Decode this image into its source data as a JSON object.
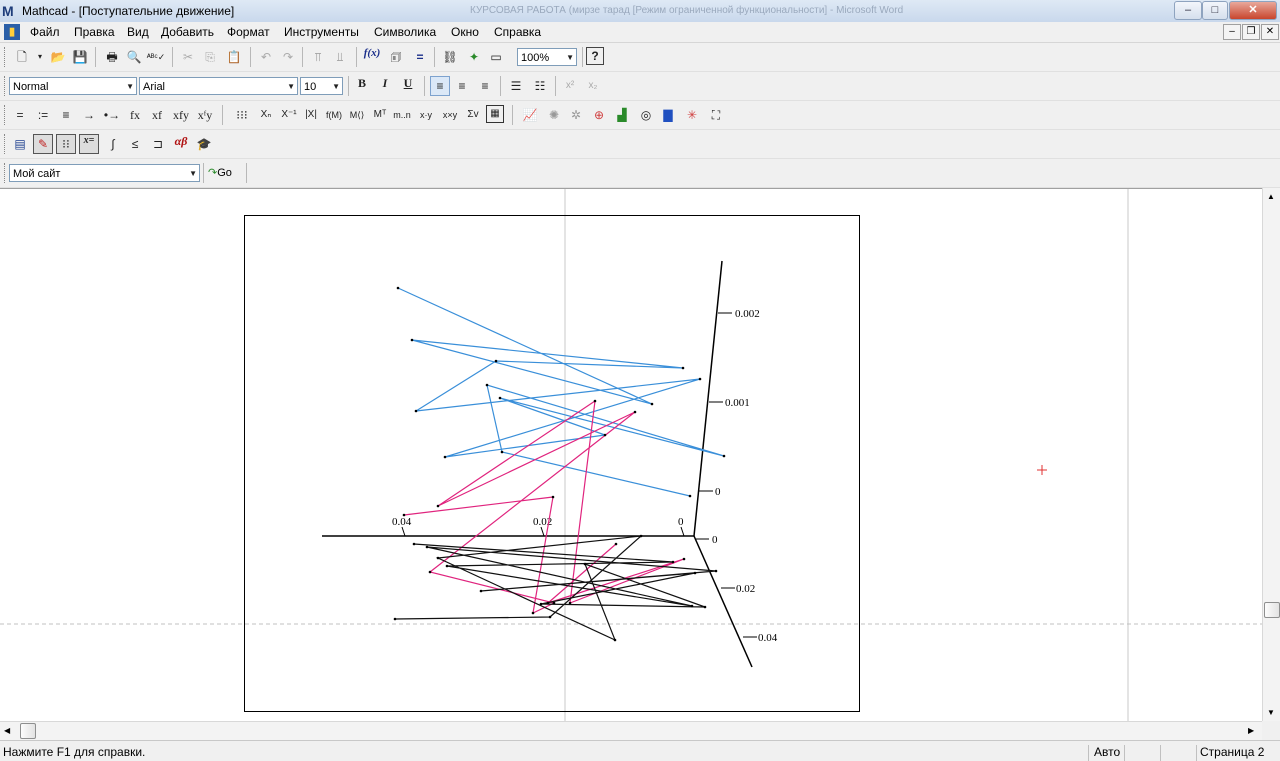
{
  "window": {
    "app_icon": "M",
    "title": "Mathcad - [Поступательние движение]",
    "background_title": "КУРСОВАЯ РАБОТА (мирзе тарад [Режим ограниченной функциональности] - Microsoft Word",
    "minimize": "–",
    "maximize": "□",
    "close": "✕"
  },
  "menu": {
    "items": [
      "Файл",
      "Правка",
      "Вид",
      "Добавить",
      "Формат",
      "Инструменты",
      "Символика",
      "Окно",
      "Справка"
    ]
  },
  "toolbar_standard": {
    "zoom_value": "100%",
    "function_label": "f(x)"
  },
  "toolbar_formatting": {
    "style_value": "Normal",
    "font_value": "Arial",
    "size_value": "10",
    "bold": "B",
    "italic": "I",
    "underline": "U",
    "superscript": "x²",
    "subscript": "x₂"
  },
  "toolbar_math_ops": {
    "items": [
      "=",
      ":=",
      "≡",
      "→",
      "•→",
      "fx",
      "xf",
      "xfy",
      "xᶠy"
    ],
    "matrix_items": [
      "Xₙ",
      "X⁻¹",
      "|X|",
      "f(M)",
      "M⟨⟩",
      "Mᵀ",
      "m..n",
      "x·y",
      "x×y",
      "Σv"
    ]
  },
  "toolbar_palettes": {
    "greek": "αβ"
  },
  "toolbar_web": {
    "site_value": "Мой сайт",
    "go_label": "Go"
  },
  "plot": {
    "axis_labels": {
      "x_left": "0.04",
      "x_mid": "0.02",
      "x_zero": "0",
      "z_top": "0.002",
      "z_mid": "0.001",
      "z_zero": "0",
      "y_zero": "0",
      "y_mid": "0.02",
      "y_far": "0.04"
    }
  },
  "colors": {
    "series_blue": "#3a8fd9",
    "series_magenta": "#e0247e",
    "series_black": "#111111",
    "cursor": "#e03030"
  },
  "status": {
    "help": "Нажмите F1 для справки.",
    "mode": "Авто",
    "page": "Страница 2"
  }
}
